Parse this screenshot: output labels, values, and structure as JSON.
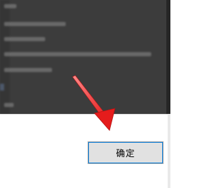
{
  "dialog": {
    "list_lines": [
      "",
      "",
      "",
      "",
      "",
      "",
      ""
    ],
    "confirm_button_label": "确定"
  },
  "annotation": {
    "arrow_color": "#e51c1c",
    "arrow_icon": "red-arrow-icon"
  },
  "colors": {
    "dimmed_background": "#3c3c3c",
    "button_face": "#e1e1e1",
    "button_focus": "#0078d7"
  }
}
